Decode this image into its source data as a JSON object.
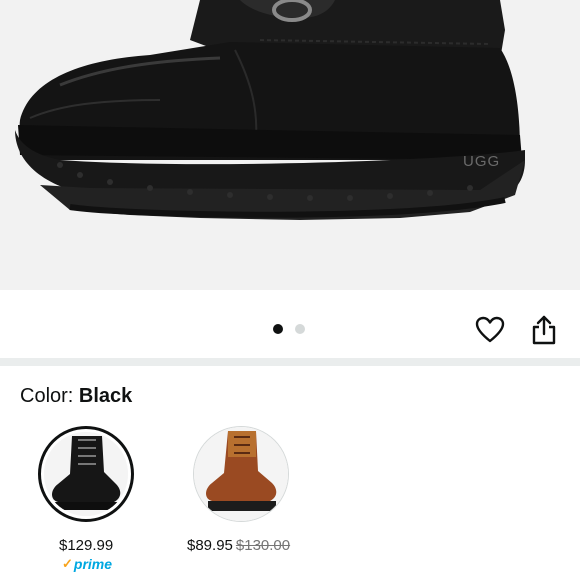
{
  "product_image": {
    "brand_mark": "UGG"
  },
  "gallery": {
    "total_images": 2,
    "current_image": 1
  },
  "actions": {
    "like_icon": "heart-icon",
    "share_icon": "share-icon"
  },
  "color": {
    "label": "Color: ",
    "value": "Black"
  },
  "swatches": [
    {
      "name": "Black",
      "price": "$129.99",
      "original_price": "",
      "badge": "prime",
      "selected": true
    },
    {
      "name": "Brown",
      "price": "$89.95",
      "original_price": "$130.00",
      "badge": "",
      "selected": false
    }
  ],
  "colors": {
    "prime_blue": "#00a8e1",
    "prime_check": "#f7a31c",
    "text": "#0f1111",
    "muted": "#767676"
  }
}
